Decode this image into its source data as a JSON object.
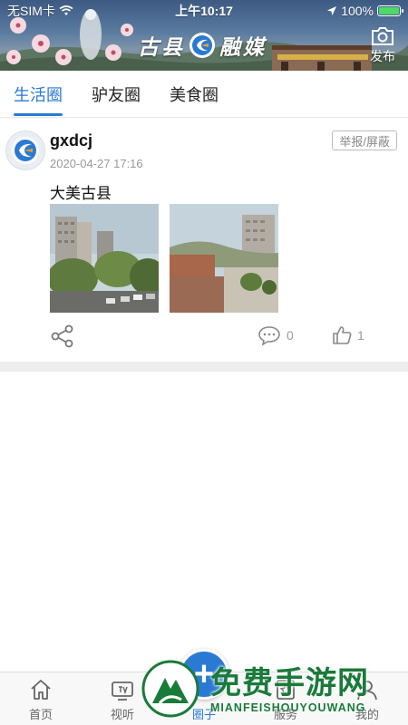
{
  "status_bar": {
    "carrier": "无SIM卡",
    "time": "上午10:17",
    "battery": "100%",
    "battery_level": 1.0
  },
  "header": {
    "brand_left": "古县",
    "brand_right": "融媒",
    "publish_label": "发布",
    "publish_icon": "camera-icon"
  },
  "tabs": [
    {
      "label": "生活圈",
      "active": true
    },
    {
      "label": "驴友圈",
      "active": false
    },
    {
      "label": "美食圈",
      "active": false
    }
  ],
  "post": {
    "username": "gxdcj",
    "timestamp": "2020-04-27 17:16",
    "report_label": "举报/屏蔽",
    "content": "大美古县",
    "comment_count": "0",
    "like_count": "1"
  },
  "bottom_nav": [
    {
      "label": "首页",
      "icon": "home-icon",
      "active": false
    },
    {
      "label": "视听",
      "icon": "tv-icon",
      "active": false
    },
    {
      "label": "圈子",
      "icon": "circle-icon",
      "active": true
    },
    {
      "label": "服务",
      "icon": "service-icon",
      "active": false
    },
    {
      "label": "我的",
      "icon": "user-icon",
      "active": false
    }
  ],
  "fab": {
    "label": "+"
  },
  "watermark": {
    "text": "免费手游网",
    "sub": "MIANFEISHOUYOUWANG"
  },
  "colors": {
    "accent": "#2a7ad4",
    "muted": "#999999",
    "divider": "#ededed"
  }
}
